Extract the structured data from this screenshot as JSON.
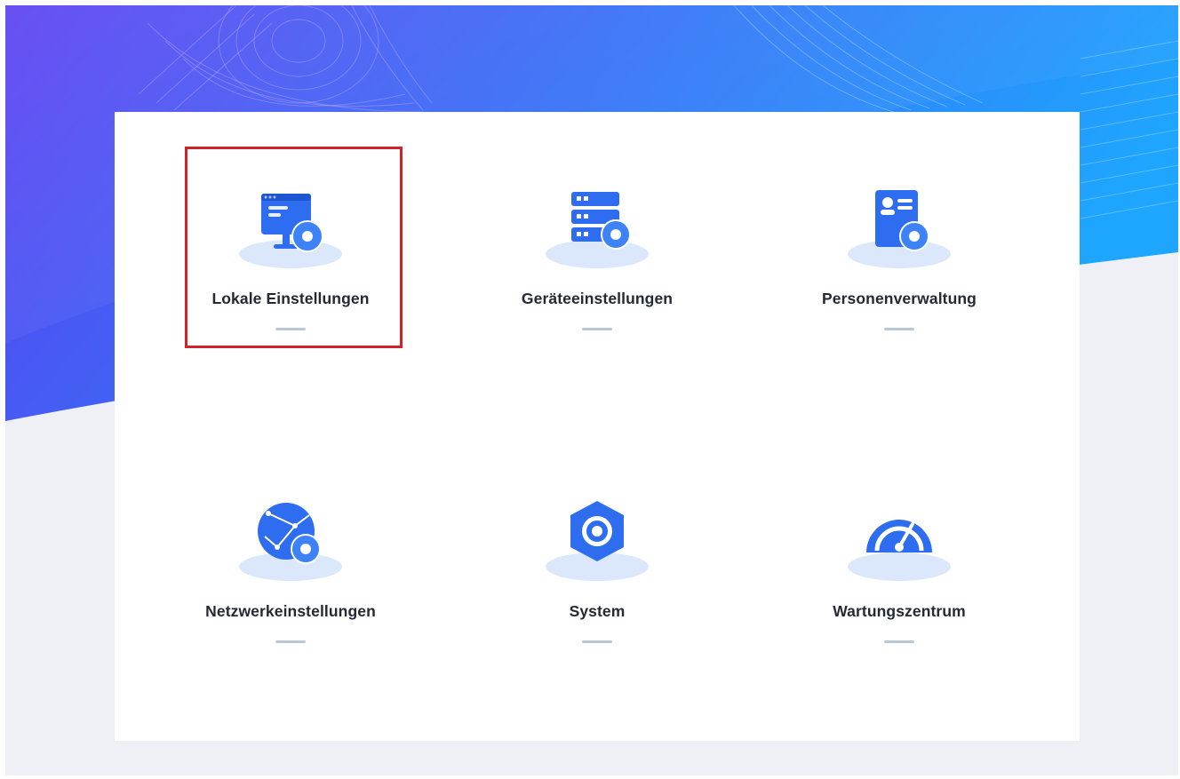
{
  "colors": {
    "hero_start": "#5b3ff2",
    "hero_end": "#1f9bff",
    "icon_blue": "#2f6df0",
    "icon_light": "#dbe7fb",
    "selection": "#d1222a"
  },
  "menu": {
    "selected_index": 0,
    "items": [
      {
        "label": "Lokale Einstellungen",
        "icon": "monitor-gear-icon"
      },
      {
        "label": "Geräteeinstellungen",
        "icon": "server-gear-icon"
      },
      {
        "label": "Personenverwaltung",
        "icon": "person-card-gear-icon"
      },
      {
        "label": "Netzwerkeinstellungen",
        "icon": "globe-gear-icon"
      },
      {
        "label": "System",
        "icon": "hexagon-gear-icon"
      },
      {
        "label": "Wartungszentrum",
        "icon": "gauge-icon"
      }
    ]
  }
}
